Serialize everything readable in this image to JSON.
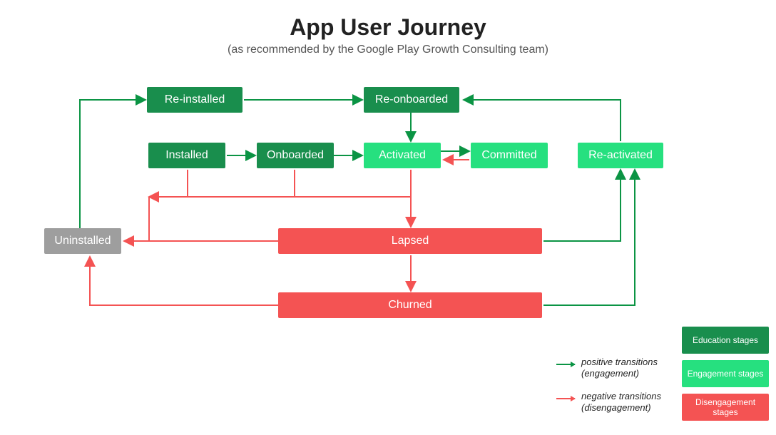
{
  "title": "App User Journey",
  "subtitle": "(as recommended by the Google Play Growth Consulting team)",
  "nodes": {
    "reinstalled": "Re-installed",
    "reonboarded": "Re-onboarded",
    "installed": "Installed",
    "onboarded": "Onboarded",
    "activated": "Activated",
    "committed": "Committed",
    "reactivated": "Re-activated",
    "uninstalled": "Uninstalled",
    "lapsed": "Lapsed",
    "churned": "Churned"
  },
  "legend": {
    "positive": "positive transitions\n(engagement)",
    "negative": "negative transitions\n(disengagement)",
    "education": "Education stages",
    "engagement": "Engagement stages",
    "disengagement": "Disengagement stages"
  },
  "colors": {
    "dark_green": "#198e4d",
    "light_green": "#26e07f",
    "red": "#f45353",
    "gray": "#9e9e9e",
    "arrow_green": "#0b9444",
    "arrow_red": "#f45353"
  },
  "edges": {
    "positive": [
      {
        "from": "reinstalled",
        "to": "reonboarded"
      },
      {
        "from": "reonboarded",
        "to": "activated"
      },
      {
        "from": "installed",
        "to": "onboarded"
      },
      {
        "from": "onboarded",
        "to": "activated"
      },
      {
        "from": "activated",
        "to": "committed"
      },
      {
        "from": "lapsed",
        "to": "reactivated"
      },
      {
        "from": "churned",
        "to": "reactivated"
      },
      {
        "from": "reactivated",
        "to": "reonboarded"
      },
      {
        "from": "uninstalled",
        "to": "reinstalled"
      }
    ],
    "negative": [
      {
        "from": "installed",
        "to": "lapsed"
      },
      {
        "from": "onboarded",
        "to": "lapsed"
      },
      {
        "from": "activated",
        "to": "lapsed"
      },
      {
        "from": "committed",
        "to": "activated"
      },
      {
        "from": "lapsed",
        "to": "uninstalled"
      },
      {
        "from": "lapsed",
        "to": "churned"
      },
      {
        "from": "churned",
        "to": "uninstalled"
      }
    ]
  }
}
